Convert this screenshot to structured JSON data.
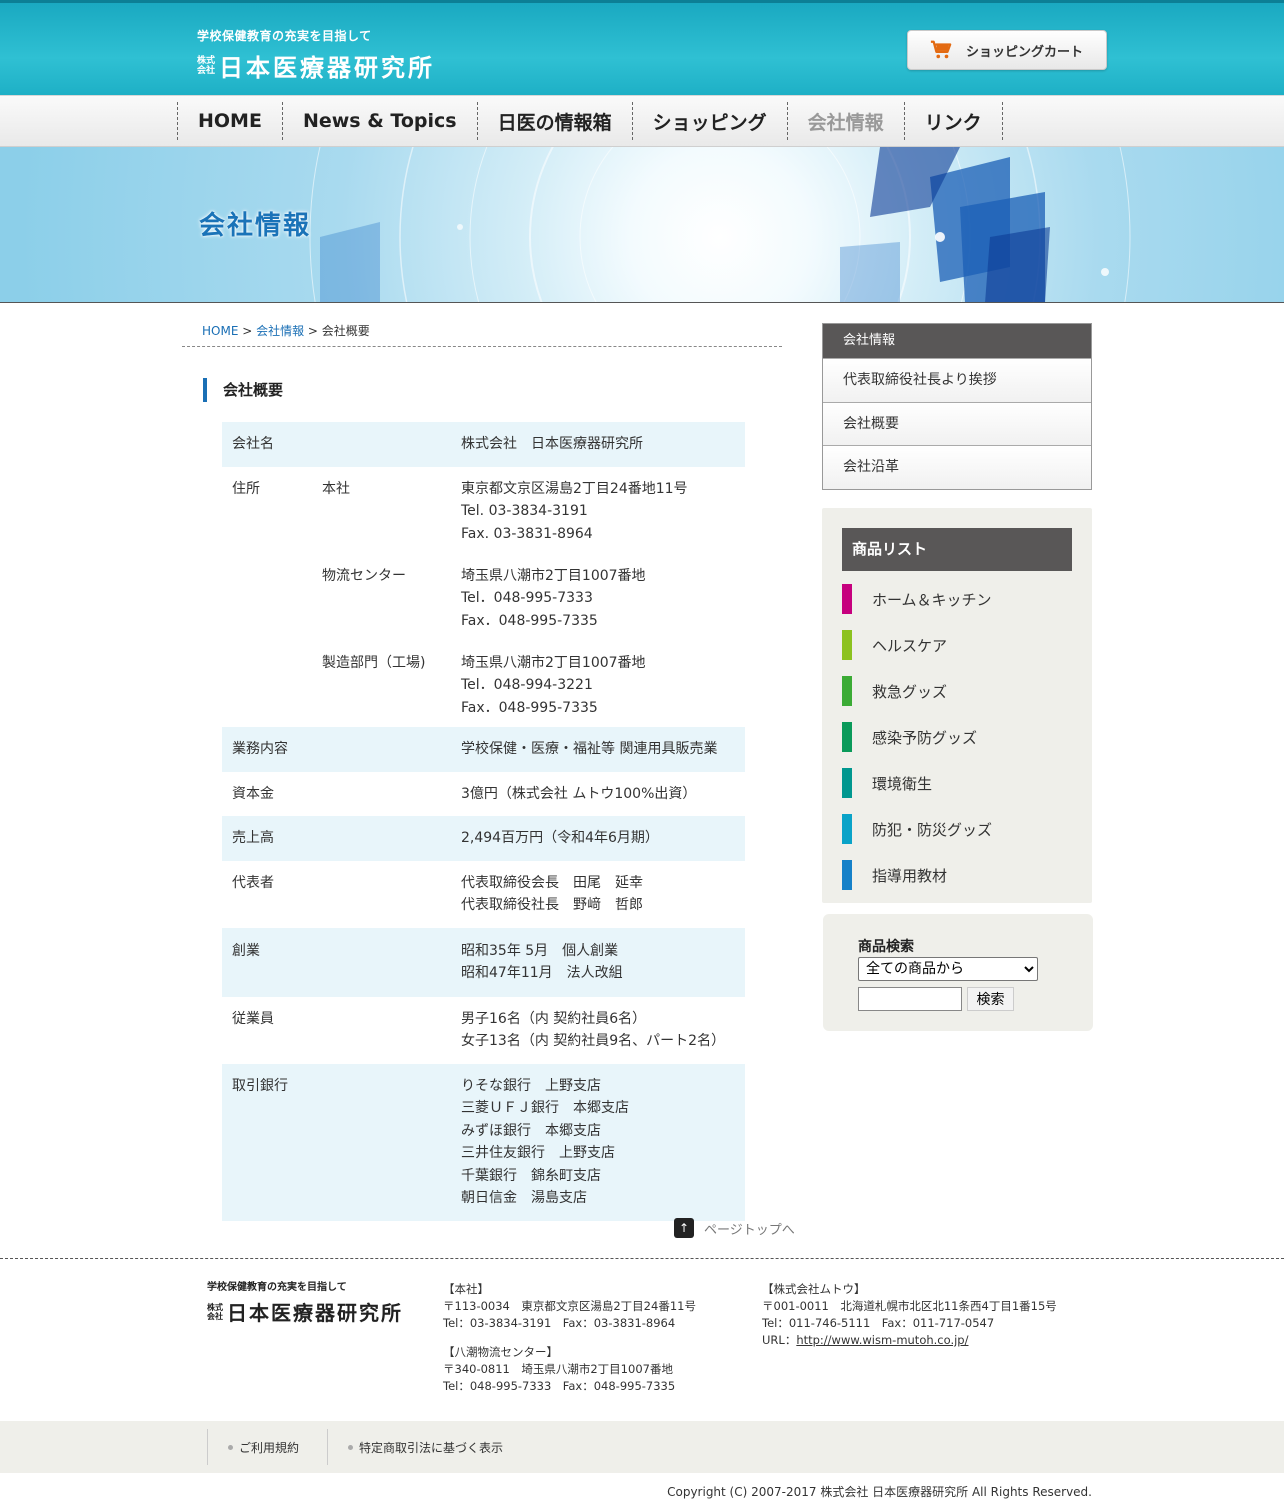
{
  "header": {
    "tagline": "学校保健教育の充実を目指して",
    "kabushiki": "株式会社",
    "company_name": "日本医療器研究所",
    "cart_label": "ショッピングカート"
  },
  "nav": {
    "items": [
      "HOME",
      "News & Topics",
      "日医の情報箱",
      "ショッピング",
      "会社情報",
      "リンク"
    ]
  },
  "hero": {
    "title": "会社情報"
  },
  "breadcrumb": {
    "home": "HOME",
    "sep1": " > ",
    "section": "会社情報",
    "sep2": " > ",
    "current": "会社概要"
  },
  "section_title": "会社概要",
  "company": {
    "name_label": "会社名",
    "name_value": "株式会社　日本医療器研究所",
    "address_label": "住所",
    "addresses": [
      {
        "label": "本社",
        "lines": [
          "東京都文京区湯島2丁目24番地11号",
          "Tel. 03-3834-3191",
          "Fax. 03-3831-8964"
        ]
      },
      {
        "label": "物流センター",
        "lines": [
          "埼玉県八潮市2丁目1007番地",
          "Tel．048-995-7333",
          "Fax．048-995-7335"
        ]
      },
      {
        "label": "製造部門（工場)",
        "lines": [
          "埼玉県八潮市2丁目1007番地",
          "Tel．048-994-3221",
          "Fax．048-995-7335"
        ]
      }
    ],
    "business_label": "業務内容",
    "business_value": "学校保健・医療・福祉等 関連用具販売業",
    "capital_label": "資本金",
    "capital_value": "3億円（株式会社 ムトウ100%出資）",
    "sales_label": "売上高",
    "sales_value": "2,494百万円（令和4年6月期）",
    "rep_label": "代表者",
    "rep_lines": [
      "代表取締役会長　田尾　延幸",
      "代表取締役社長　野﨑　哲郎"
    ],
    "founded_label": "創業",
    "founded_lines": [
      "昭和35年 5月　個人創業",
      "昭和47年11月　法人改組"
    ],
    "staff_label": "従業員",
    "staff_lines": [
      "男子16名（内 契約社員6名）",
      "女子13名（内 契約社員9名、パート2名）"
    ],
    "bank_label": "取引銀行",
    "bank_lines": [
      "りそな銀行　上野支店",
      "三菱ＵＦＪ銀行　本郷支店",
      "みずほ銀行　本郷支店",
      "三井住友銀行　上野支店",
      "千葉銀行　錦糸町支店",
      "朝日信金　湯島支店"
    ]
  },
  "pagetop": {
    "label": "ページトップへ"
  },
  "sidebar": {
    "company_header": "会社情報",
    "company_items": [
      "代表取締役社長より挨拶",
      "会社概要",
      "会社沿革"
    ],
    "products_header": "商品リスト",
    "products": [
      {
        "label": "ホーム＆キッチン",
        "color": "#c6007e"
      },
      {
        "label": "ヘルスケア",
        "color": "#8cc21f"
      },
      {
        "label": "救急グッズ",
        "color": "#3bab35"
      },
      {
        "label": "感染予防グッズ",
        "color": "#0a9a5a"
      },
      {
        "label": "環境衛生",
        "color": "#00978f"
      },
      {
        "label": "防犯・防災グッズ",
        "color": "#0aa3c8"
      },
      {
        "label": "指導用教材",
        "color": "#1580c8"
      }
    ],
    "search_label": "商品検索",
    "search_select": "全ての商品から",
    "search_button": "検索"
  },
  "footer": {
    "tagline": "学校保健教育の充実を目指して",
    "kabushiki": "株式会社",
    "company_name": "日本医療器研究所",
    "hq": [
      "【本社】",
      "〒113-0034　東京都文京区湯島2丁目24番11号",
      "Tel：03-3834-3191　Fax：03-3831-8964"
    ],
    "center": [
      "【八潮物流センター】",
      "〒340-0811　埼玉県八潮市2丁目1007番地",
      "Tel：048-995-7333　Fax：048-995-7335"
    ],
    "mutoh": [
      "【株式会社ムトウ】",
      "〒001-0011　北海道札幌市北区北11条西4丁目1番15号",
      "Tel：011-746-5111　Fax：011-717-0547"
    ],
    "url_prefix": "URL：",
    "url": "http://www.wism-mutoh.co.jp/",
    "links": [
      "ご利用規約",
      "特定商取引法に基づく表示"
    ],
    "copyright": "Copyright (C) 2007-2017 株式会社 日本医療器研究所 All Rights Reserved."
  }
}
